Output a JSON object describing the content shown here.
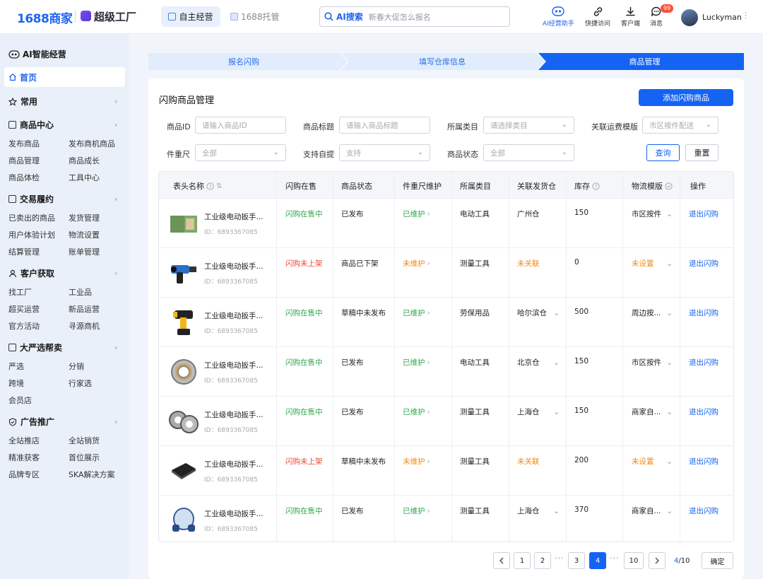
{
  "topbar": {
    "brand": "1688商家",
    "brand2": "超级工厂",
    "tab_self": "自主经营",
    "tab_host": "1688托管",
    "search_ai_label": "AI搜索",
    "search_placeholder": "新春大促怎么报名",
    "nav": [
      {
        "label": "AI经营助手",
        "icon": "robot-icon"
      },
      {
        "label": "快捷访问",
        "icon": "link-icon"
      },
      {
        "label": "客户端",
        "icon": "download-icon"
      },
      {
        "label": "消息",
        "icon": "message-icon",
        "badge": "99"
      }
    ],
    "username": "Luckyman"
  },
  "sidebar": {
    "ai_title": "AI智能经营",
    "home": "首页",
    "groups": [
      {
        "title": "常用",
        "icon": "star-icon",
        "items": []
      },
      {
        "title": "商品中心",
        "icon": "box-icon",
        "items": [
          "发布商品",
          "发布商机商品",
          "商品管理",
          "商品成长",
          "商品体检",
          "工具中心"
        ]
      },
      {
        "title": "交易履约",
        "icon": "trade-icon",
        "items": [
          "已卖出的商品",
          "发货管理",
          "用户体验计划",
          "物流设置",
          "结算管理",
          "账单管理"
        ]
      },
      {
        "title": "客户获取",
        "icon": "user-icon",
        "items": [
          "找工厂",
          "工业品",
          "超买运营",
          "新品运营",
          "官方活动",
          "寻源商机"
        ]
      },
      {
        "title": "大严选帮卖",
        "icon": "select-icon",
        "items": [
          "严选",
          "分销",
          "跨境",
          "行家选",
          "会员店"
        ]
      },
      {
        "title": "广告推广",
        "icon": "ad-icon",
        "items": [
          "全站推店",
          "全站销货",
          "精准获客",
          "首位展示",
          "品牌专区",
          "SKA解决方案"
        ]
      }
    ]
  },
  "steps": [
    "报名闪购",
    "填写仓库信息",
    "商品管理"
  ],
  "card": {
    "title": "闪购商品管理",
    "add_button": "添加闪购商品"
  },
  "filters": {
    "product_id": {
      "label": "商品ID",
      "placeholder": "请输入商品ID"
    },
    "product_title": {
      "label": "商品标题",
      "placeholder": "请输入商品标题"
    },
    "category": {
      "label": "所属类目",
      "placeholder": "请选择类目"
    },
    "shipping_template": {
      "label": "关联运费模版",
      "placeholder": "市区按件配送"
    },
    "weight_size": {
      "label": "件重尺",
      "value": "全部"
    },
    "self_pickup": {
      "label": "支持自提",
      "value": "支持"
    },
    "status": {
      "label": "商品状态",
      "value": "全部"
    },
    "query": "查询",
    "reset": "重置"
  },
  "table": {
    "headers": [
      "表头名称",
      "闪购在售",
      "商品状态",
      "件重尺维护",
      "所属类目",
      "关联发货仓",
      "库存",
      "物流模版",
      "操作"
    ],
    "rows": [
      {
        "name": "工业级电动扳手...",
        "id": "ID：6893367085",
        "sale": "闪购在售中",
        "sale_color": "green",
        "status": "已发布",
        "maint": "已维护",
        "maint_color": "green",
        "category": "电动工具",
        "wh": "广州仓",
        "wh_color": "normal",
        "wh_chev": false,
        "stock": "150",
        "logi": "市区按件",
        "logi_color": "normal",
        "op": "退出闪购",
        "thumb": "box"
      },
      {
        "name": "工业级电动扳手...",
        "id": "ID：6893367085",
        "sale": "闪购未上架",
        "sale_color": "red",
        "status": "商品已下架",
        "maint": "未维护",
        "maint_color": "orange",
        "category": "测量工具",
        "wh": "未关联",
        "wh_color": "orange",
        "wh_chev": false,
        "stock": "0",
        "logi": "未设置",
        "logi_color": "orange",
        "op": "退出闪购",
        "thumb": "heatgun"
      },
      {
        "name": "工业级电动扳手...",
        "id": "ID：6893367085",
        "sale": "闪购在售中",
        "sale_color": "green",
        "status": "草稿中未发布",
        "maint": "已维护",
        "maint_color": "green",
        "category": "劳保用品",
        "wh": "哈尔滨仓",
        "wh_color": "normal",
        "wh_chev": true,
        "stock": "500",
        "logi": "周边按...",
        "logi_color": "normal",
        "op": "退出闪购",
        "thumb": "drill"
      },
      {
        "name": "工业级电动扳手...",
        "id": "ID：6893367085",
        "sale": "闪购在售中",
        "sale_color": "green",
        "status": "已发布",
        "maint": "已维护",
        "maint_color": "green",
        "category": "电动工具",
        "wh": "北京仓",
        "wh_color": "normal",
        "wh_chev": true,
        "stock": "150",
        "logi": "市区按件",
        "logi_color": "normal",
        "op": "退出闪购",
        "thumb": "bearing"
      },
      {
        "name": "工业级电动扳手...",
        "id": "ID：6893367085",
        "sale": "闪购在售中",
        "sale_color": "green",
        "status": "已发布",
        "maint": "已维护",
        "maint_color": "green",
        "category": "测量工具",
        "wh": "上海仓",
        "wh_color": "normal",
        "wh_chev": true,
        "stock": "150",
        "logi": "商家自...",
        "logi_color": "normal",
        "op": "退出闪购",
        "thumb": "bearings"
      },
      {
        "name": "工业级电动扳手...",
        "id": "ID：6893367085",
        "sale": "闪购未上架",
        "sale_color": "red",
        "status": "草稿中未发布",
        "maint": "未维护",
        "maint_color": "orange",
        "category": "测量工具",
        "wh": "未关联",
        "wh_color": "orange",
        "wh_chev": false,
        "stock": "200",
        "logi": "未设置",
        "logi_color": "orange",
        "op": "退出闪购",
        "thumb": "chip"
      },
      {
        "name": "工业级电动扳手...",
        "id": "ID：6893367085",
        "sale": "闪购在售中",
        "sale_color": "green",
        "status": "已发布",
        "maint": "已维护",
        "maint_color": "green",
        "category": "测量工具",
        "wh": "上海仓",
        "wh_color": "normal",
        "wh_chev": true,
        "stock": "370",
        "logi": "商家自...",
        "logi_color": "normal",
        "op": "退出闪购",
        "thumb": "mask"
      }
    ]
  },
  "pagination": {
    "pages": [
      "1",
      "2",
      "3",
      "4",
      "10"
    ],
    "current": "4",
    "ellipsis": "···",
    "current_of_total": "4",
    "total_label": "/10",
    "confirm": "确定"
  }
}
